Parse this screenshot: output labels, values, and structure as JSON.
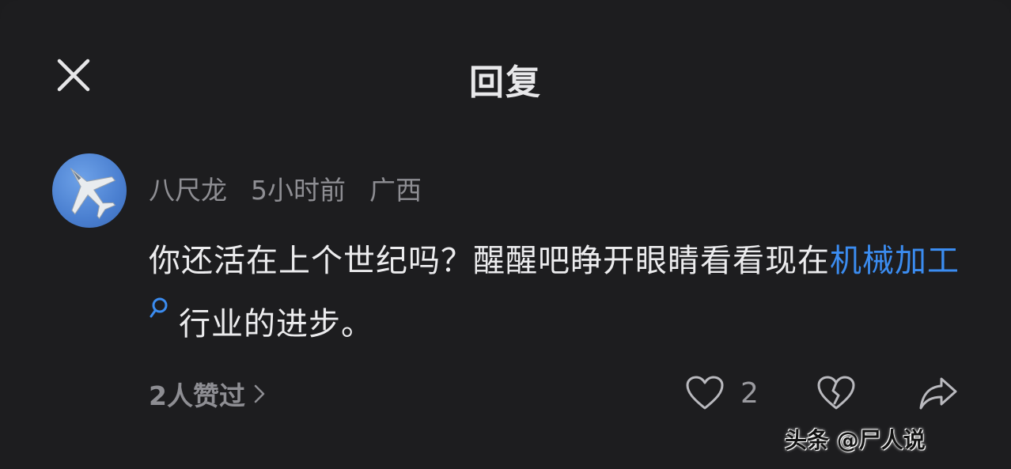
{
  "header": {
    "title": "回复",
    "close_icon": "close-icon"
  },
  "comment": {
    "avatar_icon": "fighter-jet-avatar",
    "username": "八尺龙",
    "time": "5小时前",
    "location": "广西",
    "text_before": "你还活在上个世纪吗？醒醒吧睁开眼睛看看现在",
    "link_text": "机械加工",
    "text_after": "行业的进步。",
    "link_color": "#3b8cf0"
  },
  "footer": {
    "likes_summary": "2人赞过",
    "like_count": "2",
    "like_icon": "heart-icon",
    "dislike_icon": "broken-heart-icon",
    "share_icon": "share-arrow-icon"
  },
  "watermark": {
    "text": "头条 @尸人说"
  }
}
